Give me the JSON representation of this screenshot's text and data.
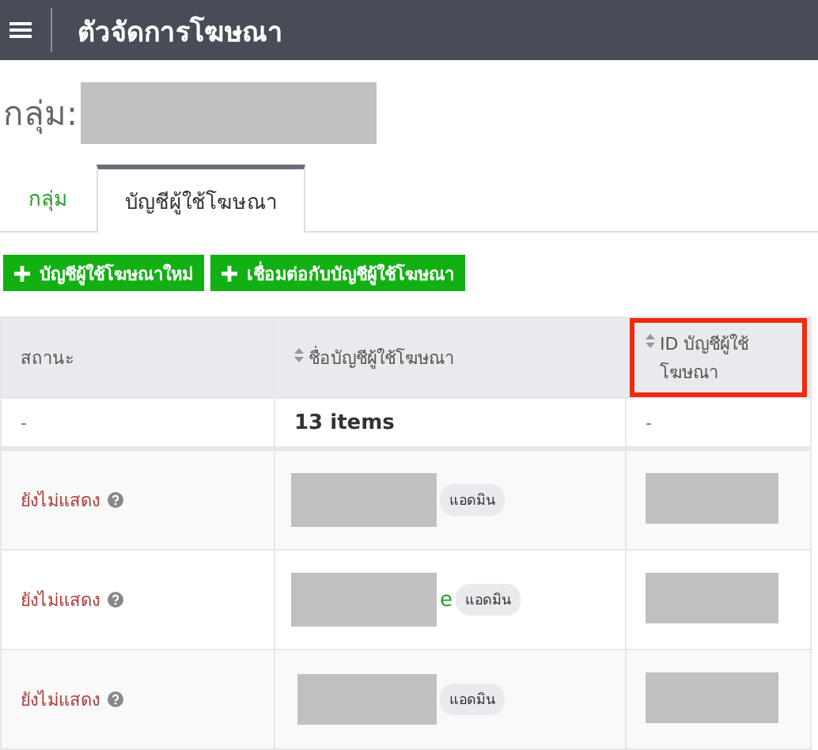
{
  "app_bar": {
    "title": "ตัวจัดการโฆษณา"
  },
  "group": {
    "label": "กลุ่ม:"
  },
  "tabs": [
    {
      "label": "กลุ่ม",
      "selected": false
    },
    {
      "label": "บัญชีผู้ใช้โฆษณา",
      "selected": true
    }
  ],
  "buttons": [
    {
      "label": "บัญชีผู้ใช้โฆษณาใหม่"
    },
    {
      "label": "เชื่อมต่อกับบัญชีผู้ใช้โฆษณา"
    }
  ],
  "table": {
    "columns": [
      {
        "label": "สถานะ",
        "sortable": false,
        "highlighted": false
      },
      {
        "label": "ชื่อบัญชีผู้ใช้โฆษณา",
        "sortable": true,
        "highlighted": false
      },
      {
        "label": "ID บัญชีผู้ใช้โฆษณา",
        "sortable": true,
        "highlighted": true
      }
    ],
    "summary": [
      "-",
      "13 items",
      "-"
    ],
    "rows": [
      {
        "status": "ยังไม่แสดง",
        "name_tail": "",
        "badge": "แอดมิน"
      },
      {
        "status": "ยังไม่แสดง",
        "name_tail": "e",
        "badge": "แอดมิน"
      },
      {
        "status": "ยังไม่แสดง",
        "name_tail": "",
        "badge": "แอดมิน"
      }
    ]
  }
}
